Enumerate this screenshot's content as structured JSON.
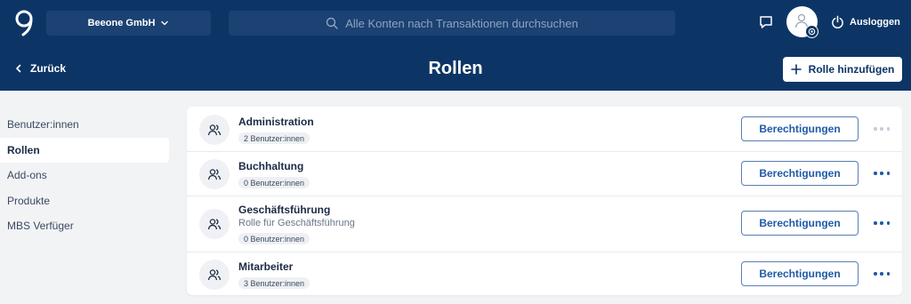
{
  "header": {
    "company": "Beeone GmbH",
    "search_placeholder": "Alle Konten nach Transaktionen durchsuchen",
    "logout_label": "Ausloggen",
    "back_label": "Zurück",
    "page_title": "Rollen",
    "add_role_label": "Rolle hinzufügen"
  },
  "sidebar": {
    "items": [
      {
        "label": "Benutzer:innen"
      },
      {
        "label": "Rollen"
      },
      {
        "label": "Add-ons"
      },
      {
        "label": "Produkte"
      },
      {
        "label": "MBS Verfüger"
      }
    ],
    "active": "Rollen"
  },
  "roles": [
    {
      "name": "Administration",
      "description": "",
      "members": "2 Benutzer:innen",
      "button": "Berechtigungen",
      "more_enabled": false
    },
    {
      "name": "Buchhaltung",
      "description": "",
      "members": "0 Benutzer:innen",
      "button": "Berechtigungen",
      "more_enabled": true
    },
    {
      "name": "Geschäftsführung",
      "description": "Rolle für Geschäftsführung",
      "members": "0 Benutzer:innen",
      "button": "Berechtigungen",
      "more_enabled": true
    },
    {
      "name": "Mitarbeiter",
      "description": "",
      "members": "3 Benutzer:innen",
      "button": "Berechtigungen",
      "more_enabled": true
    }
  ],
  "colors": {
    "header_bg": "#0c3566",
    "accent": "#1f5aa6",
    "page_bg": "#f2f3f5"
  },
  "icons": {
    "logo": "brand-logo-icon",
    "company_chevron": "chevron-down-icon",
    "search": "search-icon",
    "chat": "chat-icon",
    "avatar": "user-icon",
    "avatar_badge": "settings-icon",
    "logout": "power-icon",
    "back": "chevron-left-icon",
    "add": "plus-icon",
    "role": "users-icon",
    "more": "more-horizontal-icon"
  }
}
